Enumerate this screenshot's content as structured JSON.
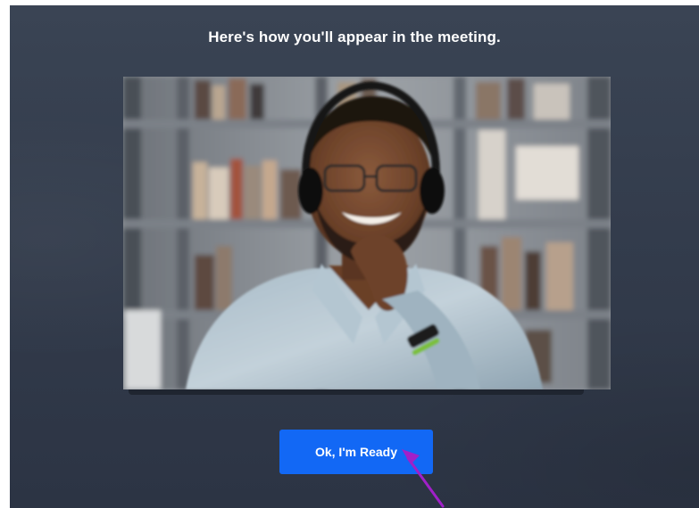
{
  "dialog": {
    "title": "Here's how you'll appear in the meeting.",
    "ready_button_label": "Ok, I'm Ready"
  },
  "preview": {
    "icon": "camera-preview"
  },
  "colors": {
    "background": "#353e4e",
    "button": "#1268f5",
    "button_text": "#ffffff",
    "annotation_arrow": "#a020c8"
  }
}
